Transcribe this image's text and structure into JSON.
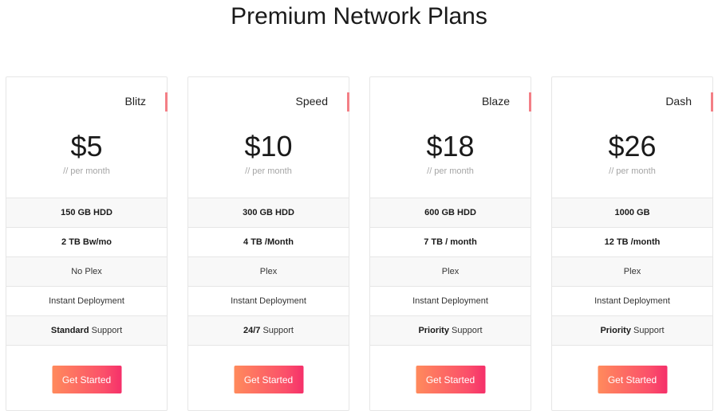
{
  "page": {
    "title": "Premium Network Plans"
  },
  "theme": {
    "accent": "#f37f86",
    "button_gradient_start": "#ff8a5c",
    "button_gradient_end": "#f5306a"
  },
  "plans": [
    {
      "name": "Blitz",
      "price": "$5",
      "period": "// per month",
      "features": [
        {
          "bold": "150 GB HDD",
          "rest": ""
        },
        {
          "bold": "2 TB Bw/mo",
          "rest": ""
        },
        {
          "bold": "",
          "rest": "No Plex"
        },
        {
          "bold": "",
          "rest": "Instant Deployment"
        },
        {
          "bold": "Standard",
          "rest": " Support"
        }
      ],
      "cta": "Get Started"
    },
    {
      "name": "Speed",
      "price": "$10",
      "period": "// per month",
      "features": [
        {
          "bold": "300 GB HDD",
          "rest": ""
        },
        {
          "bold": "4 TB /Month",
          "rest": ""
        },
        {
          "bold": "",
          "rest": "Plex"
        },
        {
          "bold": "",
          "rest": "Instant Deployment"
        },
        {
          "bold": "24/7",
          "rest": " Support"
        }
      ],
      "cta": "Get Started"
    },
    {
      "name": "Blaze",
      "price": "$18",
      "period": "// per month",
      "features": [
        {
          "bold": "600 GB HDD",
          "rest": ""
        },
        {
          "bold": "7 TB / month",
          "rest": ""
        },
        {
          "bold": "",
          "rest": "Plex"
        },
        {
          "bold": "",
          "rest": "Instant Deployment"
        },
        {
          "bold": "Priority",
          "rest": " Support"
        }
      ],
      "cta": "Get Started"
    },
    {
      "name": "Dash",
      "price": "$26",
      "period": "// per month",
      "features": [
        {
          "bold": "1000 GB",
          "rest": ""
        },
        {
          "bold": "12 TB /month",
          "rest": ""
        },
        {
          "bold": "",
          "rest": "Plex"
        },
        {
          "bold": "",
          "rest": "Instant Deployment"
        },
        {
          "bold": "Priority",
          "rest": " Support"
        }
      ],
      "cta": "Get Started"
    }
  ]
}
